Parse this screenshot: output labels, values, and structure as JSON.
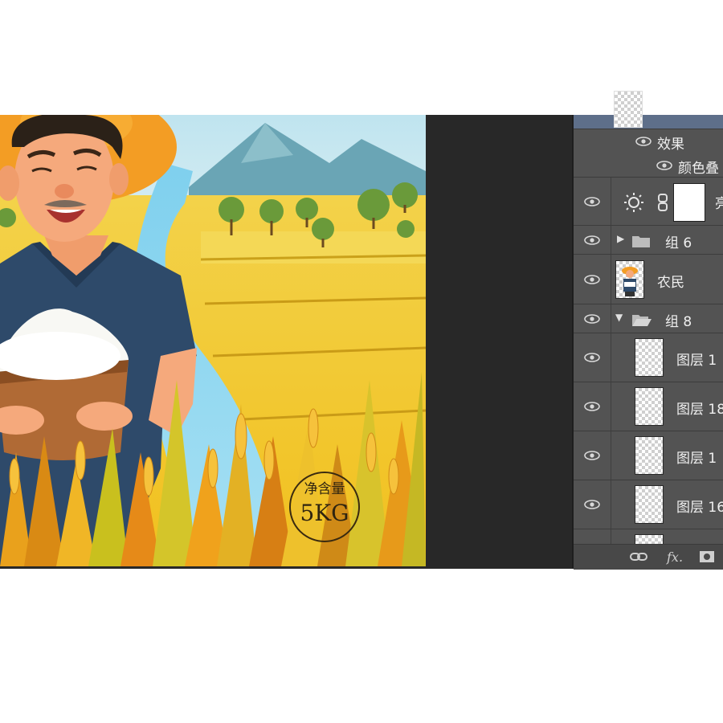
{
  "artwork": {
    "stamp_top_text": "净含量",
    "stamp_bottom_text": "5KG"
  },
  "layers_panel": {
    "effects_label": "效果",
    "color_overlay_label": "颜色叠",
    "brightness_layer_label": "亮",
    "group6_label": "组 6",
    "farmer_layer_label": "农民",
    "group8_label": "组 8",
    "layers": [
      {
        "label": "图层 1"
      },
      {
        "label": "图层 18"
      },
      {
        "label": "图层 1"
      },
      {
        "label": "图层 16"
      }
    ]
  },
  "footer": {
    "link_icon": "link-icon",
    "fx_label": "fx.",
    "mask_icon": "mask-icon"
  }
}
